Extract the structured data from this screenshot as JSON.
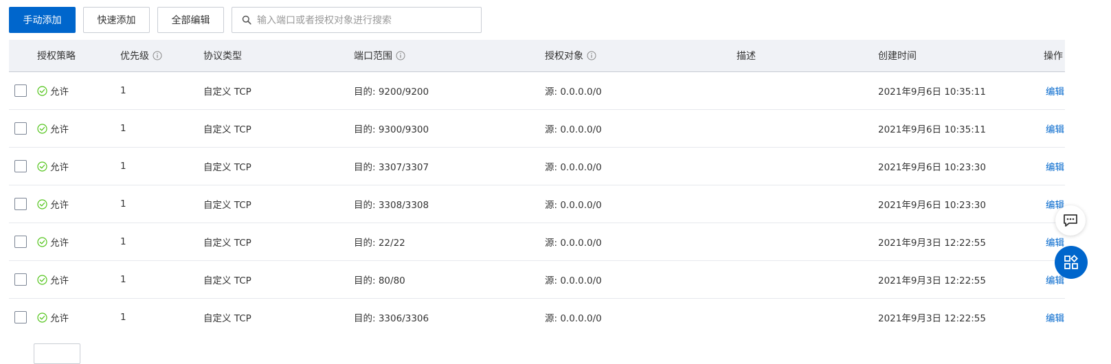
{
  "toolbar": {
    "manual_add": "手动添加",
    "quick_add": "快速添加",
    "edit_all": "全部编辑",
    "search_placeholder": "输入端口或者授权对象进行搜索"
  },
  "table": {
    "headers": {
      "policy": "授权策略",
      "priority": "优先级",
      "protocol": "协议类型",
      "port_range": "端口范围",
      "auth_object": "授权对象",
      "description": "描述",
      "created": "创建时间",
      "actions": "操作"
    },
    "rows": [
      {
        "policy": "允许",
        "priority": "1",
        "protocol": "自定义 TCP",
        "port": "目的: 9200/9200",
        "object": "源: 0.0.0.0/0",
        "description": "",
        "created": "2021年9月6日 10:35:11",
        "action": "编辑"
      },
      {
        "policy": "允许",
        "priority": "1",
        "protocol": "自定义 TCP",
        "port": "目的: 9300/9300",
        "object": "源: 0.0.0.0/0",
        "description": "",
        "created": "2021年9月6日 10:35:11",
        "action": "编辑"
      },
      {
        "policy": "允许",
        "priority": "1",
        "protocol": "自定义 TCP",
        "port": "目的: 3307/3307",
        "object": "源: 0.0.0.0/0",
        "description": "",
        "created": "2021年9月6日 10:23:30",
        "action": "编辑"
      },
      {
        "policy": "允许",
        "priority": "1",
        "protocol": "自定义 TCP",
        "port": "目的: 3308/3308",
        "object": "源: 0.0.0.0/0",
        "description": "",
        "created": "2021年9月6日 10:23:30",
        "action": "编辑"
      },
      {
        "policy": "允许",
        "priority": "1",
        "protocol": "自定义 TCP",
        "port": "目的: 22/22",
        "object": "源: 0.0.0.0/0",
        "description": "",
        "created": "2021年9月3日 12:22:55",
        "action": "编辑"
      },
      {
        "policy": "允许",
        "priority": "1",
        "protocol": "自定义 TCP",
        "port": "目的: 80/80",
        "object": "源: 0.0.0.0/0",
        "description": "",
        "created": "2021年9月3日 12:22:55",
        "action": "编辑"
      },
      {
        "policy": "允许",
        "priority": "1",
        "protocol": "自定义 TCP",
        "port": "目的: 3306/3306",
        "object": "源: 0.0.0.0/0",
        "description": "",
        "created": "2021年9月3日 12:22:55",
        "action": "编辑"
      }
    ]
  },
  "colors": {
    "primary": "#0066cc",
    "allow_green": "#52c41a",
    "header_bg": "#f0f2f6",
    "link": "#0066cc"
  },
  "icons": {
    "search": "search-icon",
    "info": "info-circle-icon",
    "allow": "check-circle-icon",
    "chat": "chat-bubble-icon",
    "apps": "apps-grid-icon"
  }
}
